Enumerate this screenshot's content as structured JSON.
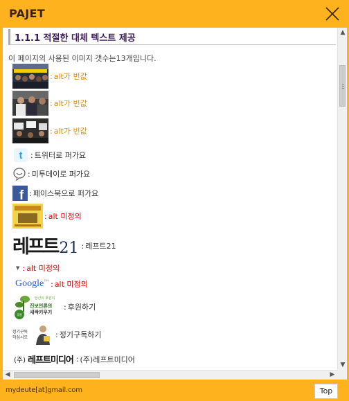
{
  "window": {
    "title": "PAJET",
    "close_label": "close"
  },
  "section": {
    "heading": "1.1.1 적절한 대체 텍스트 제공"
  },
  "summary": "이 페이지의 사용된 이미지 갯수는13개입니다.",
  "items": [
    {
      "sep": ":",
      "text": "alt가 빈값",
      "status": "empty",
      "color": "#e08a00"
    },
    {
      "sep": ":",
      "text": "alt가 빈값",
      "status": "empty",
      "color": "#e08a00"
    },
    {
      "sep": ":",
      "text": "alt가 빈값",
      "status": "empty",
      "color": "#e08a00"
    },
    {
      "sep": ":",
      "text": "트위터로 퍼가요",
      "status": "ok"
    },
    {
      "sep": ":",
      "text": "미투데이로 퍼가요",
      "status": "ok"
    },
    {
      "sep": ":",
      "text": "페이스북으로 퍼가요",
      "status": "ok"
    },
    {
      "sep": ":",
      "text": "alt 미정의",
      "status": "undefined",
      "color": "#d40000"
    },
    {
      "sep": ":",
      "text": "레프트21",
      "status": "ok",
      "logo": {
        "main": "레프트",
        "number": "21"
      }
    },
    {
      "sep": ":",
      "text": "alt 미정의",
      "status": "undefined",
      "color": "#d40000"
    },
    {
      "sep": ":",
      "text": "alt 미정의",
      "status": "undefined",
      "color": "#d40000",
      "logo": {
        "text": "Google",
        "tm": "™"
      }
    },
    {
      "sep": ":",
      "text": "후원하기",
      "status": "ok",
      "logo": {
        "line1": "당신의 후원이",
        "line2": "진보언론의",
        "line3": "새싹키우기",
        "badge": "후원"
      }
    },
    {
      "sep": ":",
      "text": "정기구독하기",
      "status": "ok",
      "logo": {
        "line1": "정기구독",
        "line2": "하십시오"
      }
    },
    {
      "sep": ":",
      "text": "(주)레프트미디어",
      "status": "ok",
      "logo": {
        "prefix": "(주)",
        "name": "레프트미디어"
      }
    }
  ],
  "footer": {
    "email": "mydeute[at]gmail.com",
    "top_label": "Top"
  }
}
